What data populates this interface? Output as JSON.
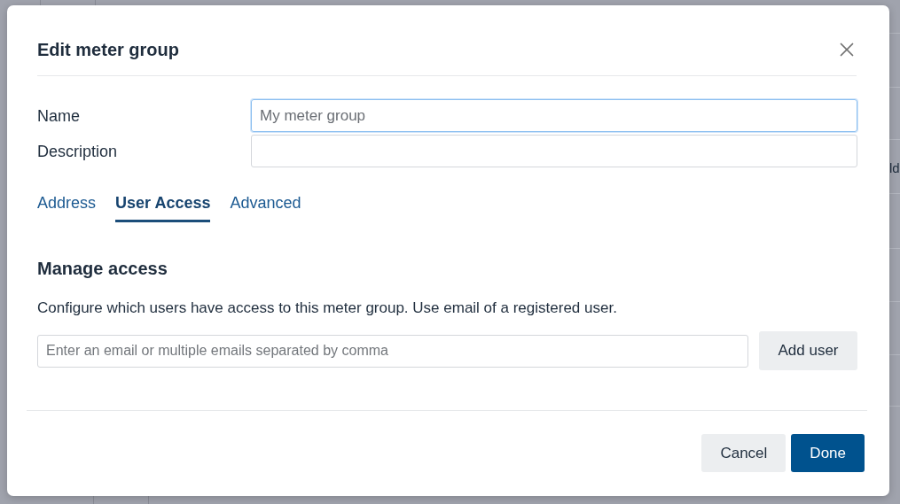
{
  "background": {
    "text_fragment": "ld"
  },
  "dialog": {
    "title": "Edit meter group",
    "fields": [
      {
        "label": "Name",
        "placeholder": "My meter group",
        "focused": true
      },
      {
        "label": "Description",
        "focused": false
      }
    ],
    "tabs": [
      {
        "label": "Address",
        "selected": false
      },
      {
        "label": "User Access",
        "selected": true
      },
      {
        "label": "Advanced",
        "selected": false
      }
    ],
    "section": {
      "heading": "Manage access",
      "description": "Configure which users have access to this meter group. Use email of a registered user.",
      "email_field": {
        "placeholder": "Enter an email or multiple emails separated by comma"
      },
      "add_button": "Add user"
    },
    "buttons": [
      {
        "label": "Cancel",
        "kind": "secondary"
      },
      {
        "label": "Done",
        "kind": "primary"
      }
    ]
  }
}
